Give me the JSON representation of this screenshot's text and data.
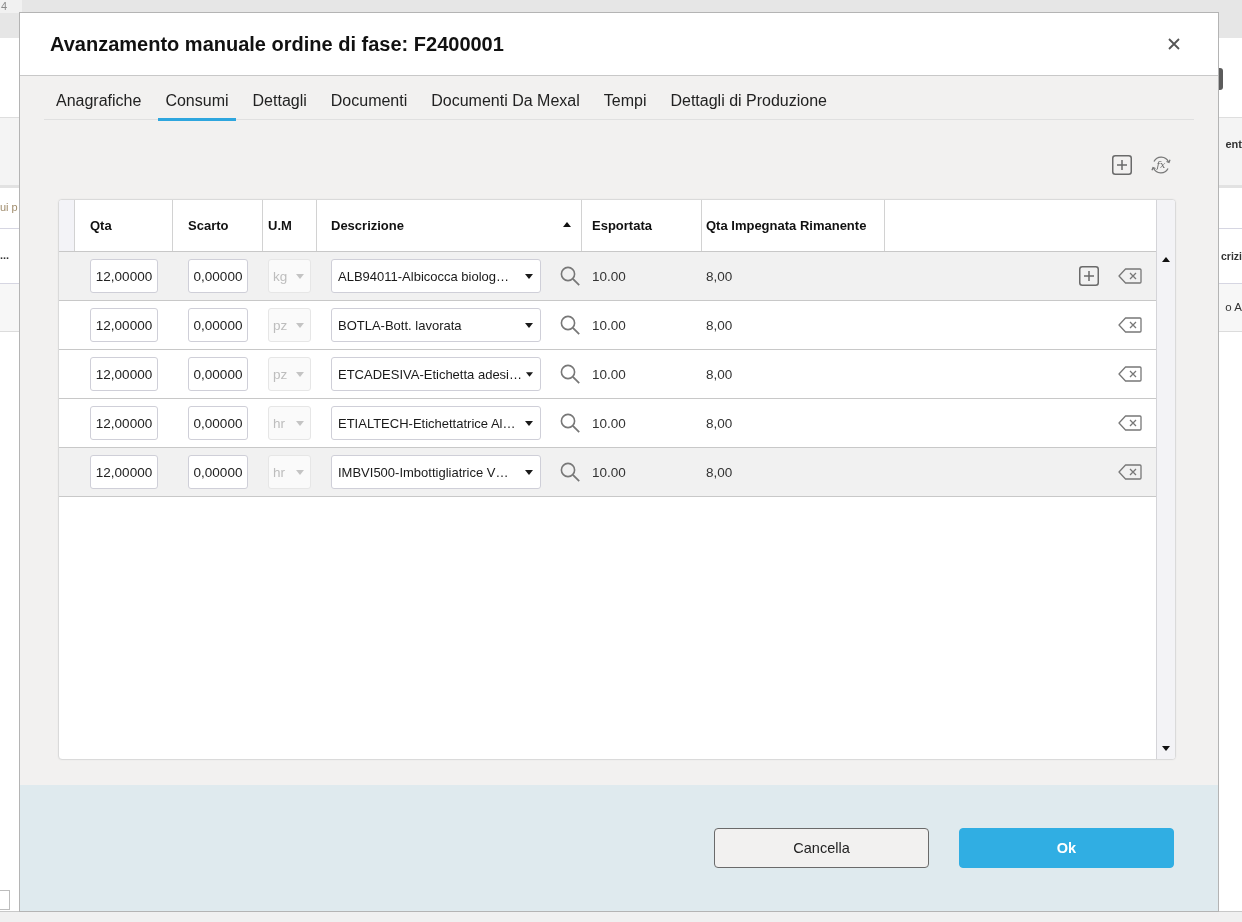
{
  "background_window": {
    "corner_label": "4",
    "left_hint_fragment": "ui p",
    "left_cell_fragment": "...",
    "right_heading_fragment": "ent",
    "right_column_fragment": "crizi",
    "right_cell_fragment": "o A"
  },
  "dialog": {
    "title": "Avanzamento manuale ordine di fase: F2400001",
    "tabs": [
      {
        "label": "Anagrafiche",
        "selected": false
      },
      {
        "label": "Consumi",
        "selected": true
      },
      {
        "label": "Dettagli",
        "selected": false
      },
      {
        "label": "Documenti",
        "selected": false
      },
      {
        "label": "Documenti Da Mexal",
        "selected": false
      },
      {
        "label": "Tempi",
        "selected": false
      },
      {
        "label": "Dettagli di Produzione",
        "selected": false
      }
    ],
    "toolbar": {
      "formula_button": "fx"
    },
    "table": {
      "columns": [
        {
          "label": "Qta",
          "sorted": false
        },
        {
          "label": "Scarto",
          "sorted": false
        },
        {
          "label": "U.M",
          "sorted": false
        },
        {
          "label": "Descrizione",
          "sorted": true
        },
        {
          "label": "Esportata",
          "sorted": false
        },
        {
          "label": "Qta Impegnata Rimanente",
          "sorted": false
        }
      ],
      "rows": [
        {
          "qta": "12,00000",
          "scarto": "0,00000",
          "um": "kg",
          "um_disabled": true,
          "descrizione": "ALB94011-Albicocca biolog…",
          "esportata": "10.00",
          "qta_impegnata_rimanente": "8,00",
          "highlighted": true,
          "add_button": true
        },
        {
          "qta": "12,00000",
          "scarto": "0,00000",
          "um": "pz",
          "um_disabled": true,
          "descrizione": "BOTLA-Bott. lavorata",
          "esportata": "10.00",
          "qta_impegnata_rimanente": "8,00",
          "highlighted": false,
          "add_button": false
        },
        {
          "qta": "12,00000",
          "scarto": "0,00000",
          "um": "pz",
          "um_disabled": true,
          "descrizione": "ETCADESIVA-Etichetta adesi…",
          "esportata": "10.00",
          "qta_impegnata_rimanente": "8,00",
          "highlighted": false,
          "add_button": false
        },
        {
          "qta": "12,00000",
          "scarto": "0,00000",
          "um": "hr",
          "um_disabled": true,
          "descrizione": "ETIALTECH-Etichettatrice Al…",
          "esportata": "10.00",
          "qta_impegnata_rimanente": "8,00",
          "highlighted": false,
          "add_button": false
        },
        {
          "qta": "12,00000",
          "scarto": "0,00000",
          "um": "hr",
          "um_disabled": true,
          "descrizione": "IMBVI500-Imbottigliatrice V…",
          "esportata": "10.00",
          "qta_impegnata_rimanente": "8,00",
          "highlighted": true,
          "add_button": false
        }
      ]
    },
    "buttons": [
      {
        "label": "Cancella",
        "kind": "secondary"
      },
      {
        "label": "Ok",
        "kind": "primary"
      }
    ]
  }
}
